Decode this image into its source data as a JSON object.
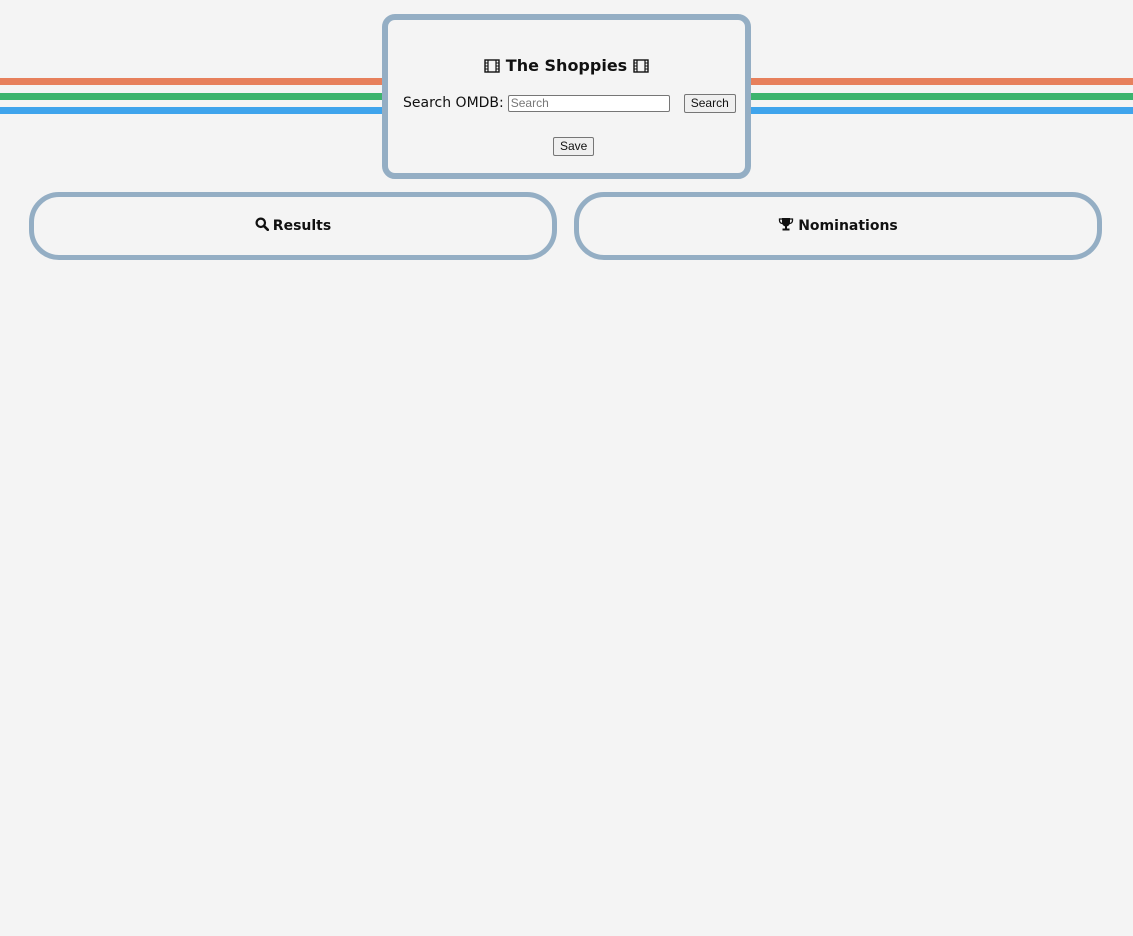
{
  "colors": {
    "background": "#f4f4f4",
    "border": "#94aec4",
    "stripe_orange": "#e7805c",
    "stripe_green": "#3cb46e",
    "stripe_blue": "#3fa4ec"
  },
  "header": {
    "title": "The Shoppies",
    "left_icon": "film-icon",
    "right_icon": "film-icon"
  },
  "search": {
    "label": "Search OMDB:",
    "placeholder": "Search",
    "value": "",
    "button_label": "Search"
  },
  "save": {
    "button_label": "Save"
  },
  "panels": {
    "results": {
      "title": "Results",
      "icon": "search-icon"
    },
    "nominations": {
      "title": "Nominations",
      "icon": "trophy-icon"
    }
  }
}
